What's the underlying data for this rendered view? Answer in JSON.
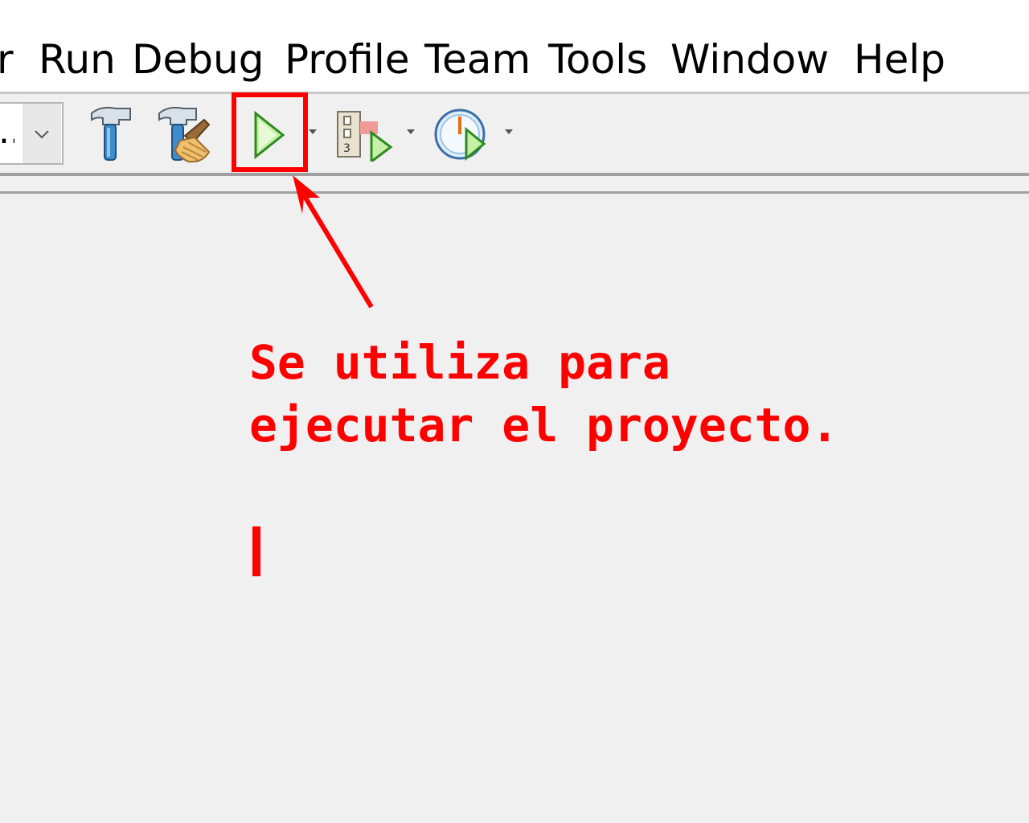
{
  "menubar": {
    "items": [
      {
        "label": "r"
      },
      {
        "label": "Run"
      },
      {
        "label": "Debug"
      },
      {
        "label": "Profile"
      },
      {
        "label": "Team"
      },
      {
        "label": "Tools"
      },
      {
        "label": "Window"
      },
      {
        "label": "Help"
      }
    ]
  },
  "toolbar": {
    "config_combo_value": "..",
    "icons": {
      "build": "hammer-icon",
      "clean_build": "hammer-broom-icon",
      "run": "play-icon",
      "run_dropdown": "chevron-down-icon",
      "debug": "debug-play-icon",
      "debug_dropdown": "chevron-down-icon",
      "profile": "clock-play-icon",
      "profile_dropdown": "chevron-down-icon"
    }
  },
  "annotation": {
    "line1": "Se utiliza para",
    "line2": "ejecutar el proyecto."
  },
  "colors": {
    "annotation": "#ff0000",
    "run_icon": "#3fa62c",
    "background": "#f0f0f0"
  }
}
